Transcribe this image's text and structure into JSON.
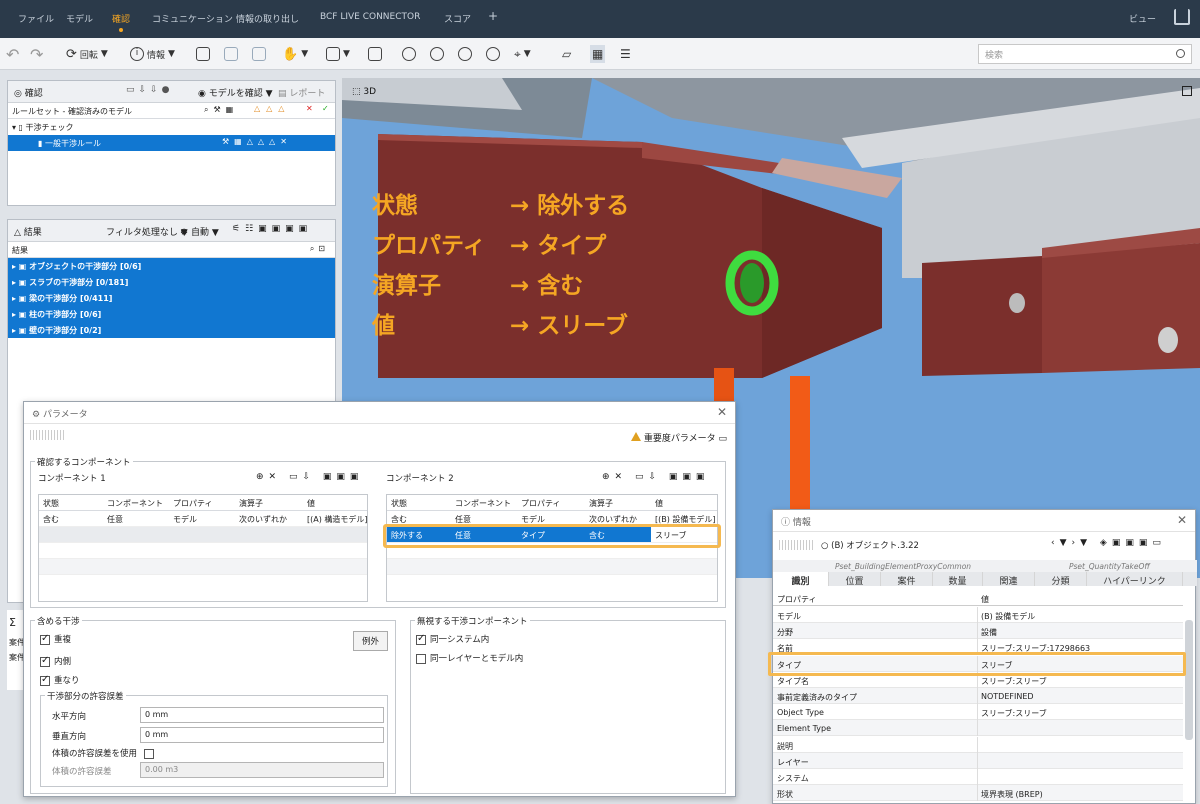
{
  "menubar": {
    "tabs": [
      "ファイル",
      "モデル",
      "確認",
      "コミュニケーション",
      "情報の取り出し",
      "BCF LIVE CONNECTOR",
      "スコア",
      "+"
    ],
    "active_tab": "確認",
    "view_label": "ビュー",
    "accent_color": "#f5a623"
  },
  "toolbar": {
    "rotate_label": "回転",
    "info_label": "情報",
    "search_placeholder": "検索"
  },
  "check_panel": {
    "title": "確認",
    "check_model_label": "モデルを確認",
    "report_label": "レポート",
    "column_header": "ルールセット - 確認済みのモデル",
    "items": [
      "干渉チェック",
      "一般干渉ルール"
    ]
  },
  "results_panel": {
    "title": "結果",
    "filter_label": "フィルタ処理なし",
    "auto_label": "自動",
    "column_header": "結果",
    "items": [
      "オブジェクトの干渉部分 [0/6]",
      "スラブの干渉部分 [0/181]",
      "梁の干渉部分 [0/411]",
      "柱の干渉部分 [0/6]",
      "壁の干渉部分 [0/2]"
    ]
  },
  "viewport": {
    "title": "3D",
    "overlay_lines": [
      {
        "left": "状態",
        "right": "→ 除外する"
      },
      {
        "left": "プロパティ",
        "right": "→ タイプ"
      },
      {
        "left": "演算子",
        "right": "→ 含む"
      },
      {
        "left": "値",
        "right": "→ スリーブ"
      }
    ],
    "sky_color": "#6ea3d9",
    "beam_color": "#7b2f2c",
    "sleeve_color": "#3fdc3f"
  },
  "bottom_left": {
    "sigma": "Σ",
    "labels": [
      "案件",
      "案件"
    ]
  },
  "param_dialog": {
    "title": "パラメータ",
    "severity_label": "重要度パラメータ",
    "components_group": "確認するコンポーネント",
    "comp1": {
      "title": "コンポーネント 1",
      "headers": [
        "状態",
        "コンポーネント",
        "プロパティ",
        "演算子",
        "値"
      ],
      "rows": [
        [
          "含む",
          "任意",
          "モデル",
          "次のいずれか",
          "[(A) 構造モデル]"
        ]
      ]
    },
    "comp2": {
      "title": "コンポーネント 2",
      "headers": [
        "状態",
        "コンポーネント",
        "プロパティ",
        "演算子",
        "値"
      ],
      "rows": [
        [
          "含む",
          "任意",
          "モデル",
          "次のいずれか",
          "[(B) 設備モデル]"
        ],
        [
          "除外する",
          "任意",
          "タイプ",
          "含む",
          "スリーブ"
        ]
      ]
    },
    "include_group": "含める干渉",
    "include_options": [
      {
        "label": "重複",
        "checked": true
      },
      {
        "label": "内側",
        "checked": true
      },
      {
        "label": "重なり",
        "checked": true
      }
    ],
    "exception_button": "例外",
    "tolerance_group": "干渉部分の許容誤差",
    "horizontal_label": "水平方向",
    "horizontal_value": "0 mm",
    "vertical_label": "垂直方向",
    "vertical_value": "0 mm",
    "volume_use_label": "体積の許容誤差を使用",
    "volume_label": "体積の許容誤差",
    "volume_value": "0.00 m3",
    "ignore_group": "無視する干渉コンポーネント",
    "ignore_options": [
      {
        "label": "同一システム内",
        "checked": true
      },
      {
        "label": "同一レイヤーとモデル内",
        "checked": false
      }
    ]
  },
  "info_panel": {
    "title": "情報",
    "object_label": "(B) オブジェクト.3.22",
    "pset_tabs": [
      "Pset_BuildingElementProxyCommon",
      "Pset_QuantityTakeOff"
    ],
    "tabs": [
      "識別",
      "位置",
      "案件",
      "数量",
      "関連",
      "分類",
      "ハイパーリンク"
    ],
    "headers": [
      "プロパティ",
      "値"
    ],
    "rows": [
      [
        "モデル",
        "(B) 設備モデル"
      ],
      [
        "分野",
        "設備"
      ],
      [
        "名前",
        "スリーブ:スリーブ:17298663"
      ],
      [
        "タイプ",
        "スリーブ"
      ],
      [
        "タイプ名",
        "スリーブ:スリーブ"
      ],
      [
        "事前定義済みのタイプ",
        "NOTDEFINED"
      ],
      [
        "Object Type",
        "スリーブ:スリーブ"
      ],
      [
        "Element Type",
        ""
      ],
      [
        "説明",
        ""
      ],
      [
        "レイヤー",
        ""
      ],
      [
        "システム",
        ""
      ],
      [
        "形状",
        "境界表現 (BREP)"
      ]
    ]
  }
}
